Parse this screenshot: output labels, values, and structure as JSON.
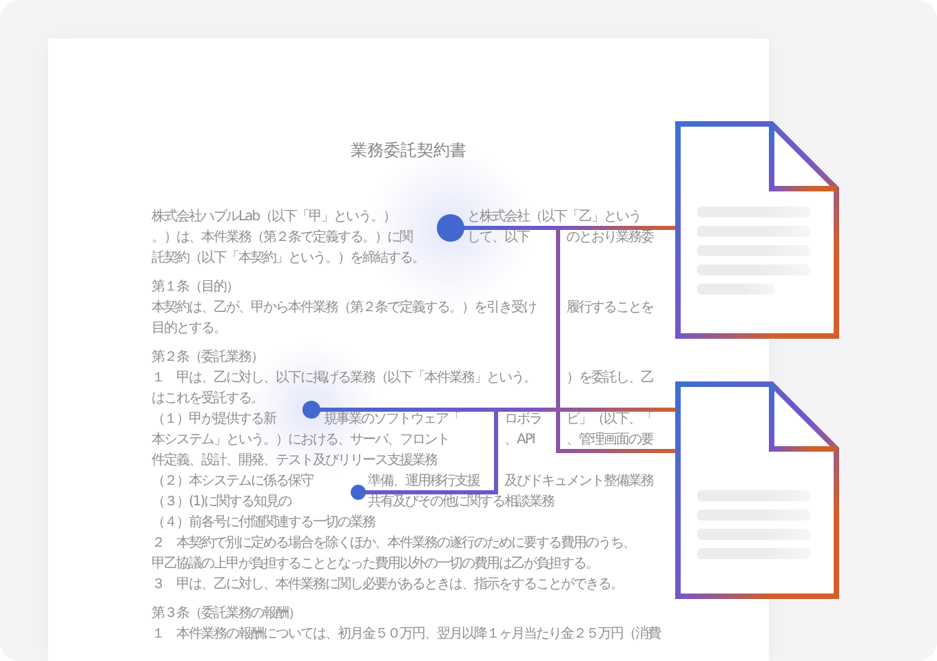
{
  "document": {
    "title": "業務委託契約書",
    "sections": [
      {
        "lines": [
          [
            "株式会社ハブルLab（以下「甲」という。）",
            "と株式会社（以下「乙」という"
          ],
          [
            "。）は、本件業務（第２条で定義する。）に関",
            "して、以下",
            "のとおり業務委"
          ],
          [
            "託契約（以下「本契約」という。）を締結する。"
          ]
        ]
      },
      {
        "lines": [
          [
            "第１条（目的）"
          ],
          [
            "本契約は、乙が、甲から本件業務（第２条で定義する。）を引き受け",
            "履行することを"
          ],
          [
            "目的とする。"
          ]
        ]
      },
      {
        "lines": [
          [
            "第２条（委託業務）"
          ],
          [
            "１　甲は、乙に対し、以下に掲げる業務（以下「本件業務」という。",
            "）を委託し、乙"
          ],
          [
            "はこれを受託する。"
          ],
          [
            "（１）甲が提供する新",
            "規事業のソフトウェア「",
            "ロボラ",
            "ビ」（以下、「"
          ],
          [
            "本システム」という。）における、サーバ、フロント",
            "、API",
            "、管理画面の要"
          ],
          [
            "件定義、設計、開発、テスト及びリリース支援業務"
          ],
          [
            "（２）本システムに係る保守",
            "準備、運用移行支援",
            "及びドキュメント整備業務"
          ],
          [
            "（３）(1)に関する知見の",
            "共有及びその他に関する相談業務"
          ],
          [
            "（４）前各号に付随関連する一切の業務"
          ],
          [
            "２　本契約で別に定める場合を除くほか、本件業務の遂行のために要する費用のうち、"
          ],
          [
            "甲乙協議の上甲が負担することとなった費用以外の一切の費用は乙が負担する。"
          ],
          [
            "３　甲は、乙に対し、本件業務に関し必要があるときは、指示をすることができる。"
          ]
        ]
      },
      {
        "lines": [
          [
            "第３条（委託業務の報酬）"
          ],
          [
            "１　本件業務の報酬については、初月金５０万円、翌月以降１ヶ月当たり金２５万円（消費"
          ]
        ]
      }
    ]
  }
}
